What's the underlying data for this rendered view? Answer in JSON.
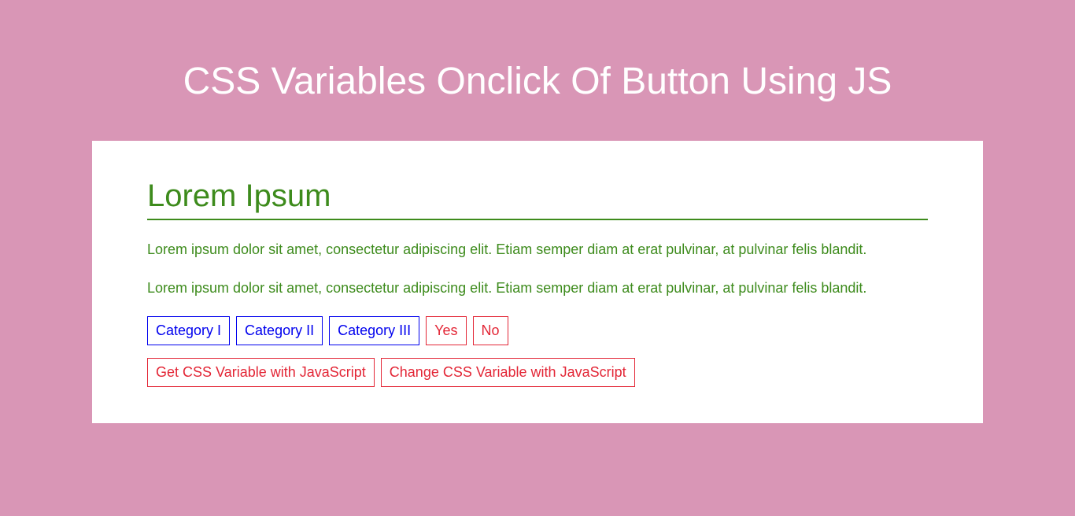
{
  "header": {
    "title": "CSS Variables Onclick Of Button Using JS"
  },
  "card": {
    "heading": "Lorem Ipsum",
    "paragraph1": "Lorem ipsum dolor sit amet, consectetur adipiscing elit. Etiam semper diam at erat pulvinar, at pulvinar felis blandit.",
    "paragraph2": "Lorem ipsum dolor sit amet, consectetur adipiscing elit. Etiam semper diam at erat pulvinar, at pulvinar felis blandit.",
    "categories": {
      "item1": "Category I",
      "item2": "Category II",
      "item3": "Category III"
    },
    "confirm": {
      "yes": "Yes",
      "no": "No"
    },
    "actions": {
      "get": "Get CSS Variable with JavaScript",
      "change": "Change CSS Variable with JavaScript"
    }
  }
}
